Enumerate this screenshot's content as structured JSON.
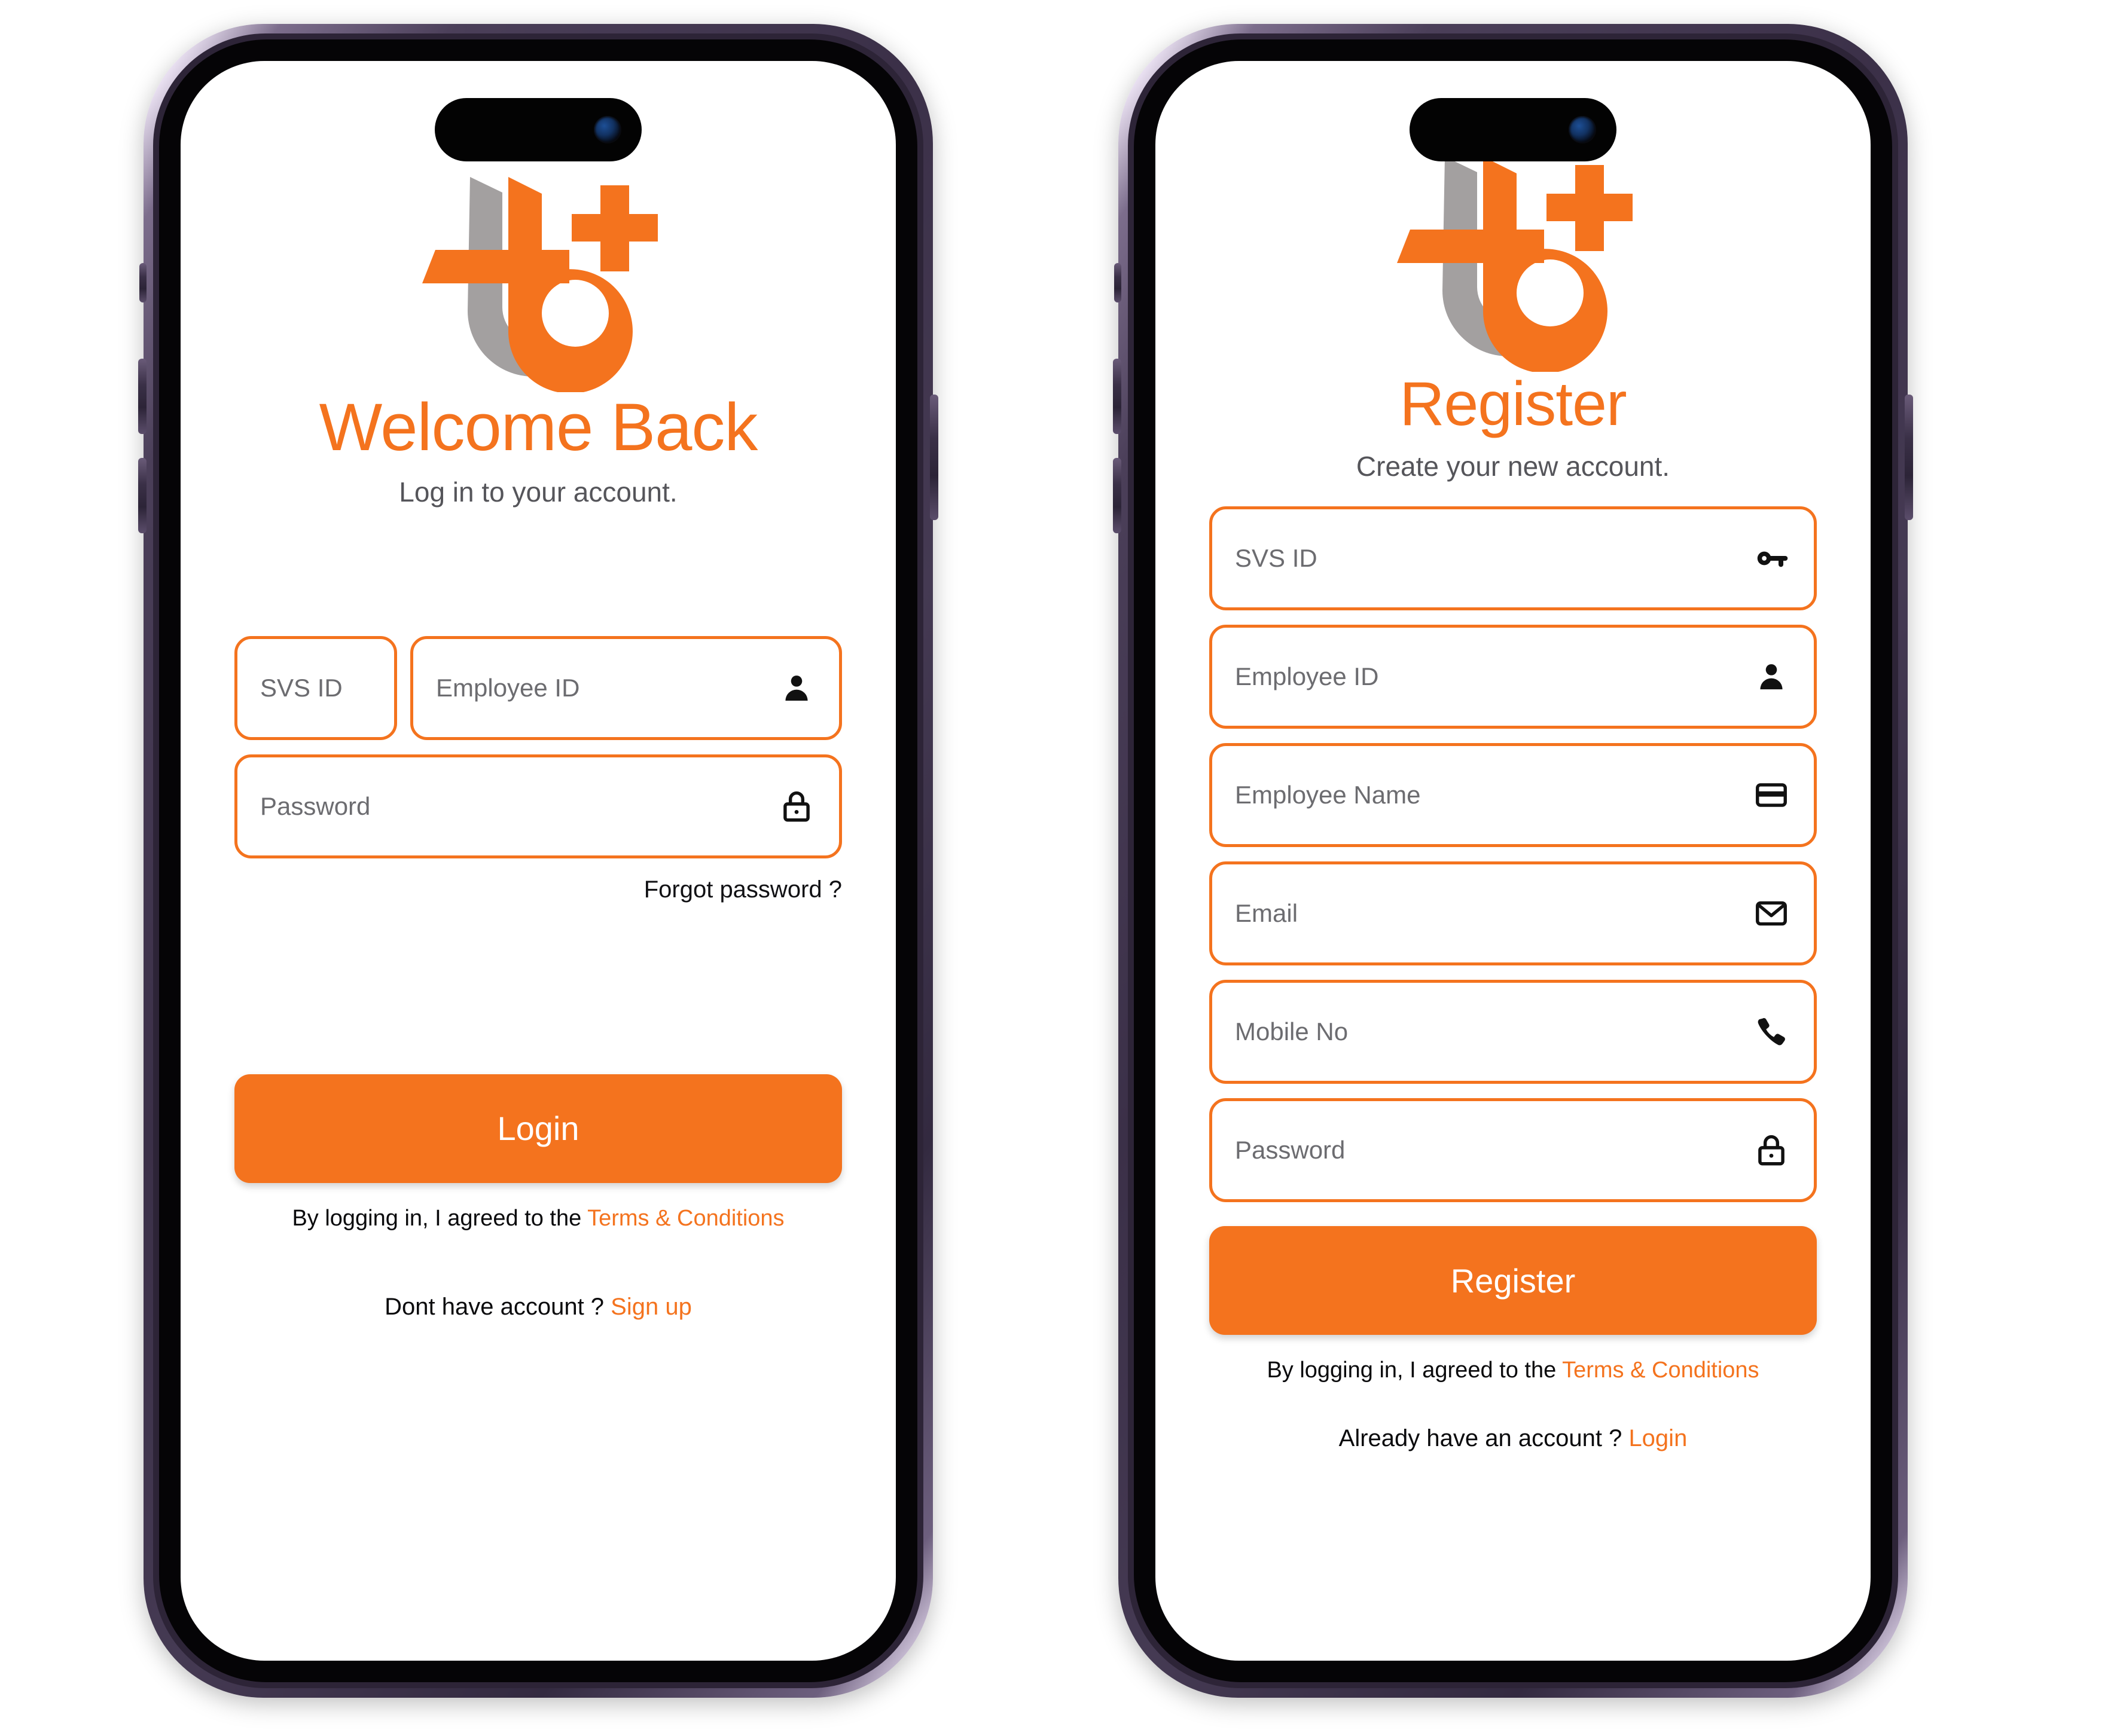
{
  "brand": {
    "accent_color": "#F4731E",
    "logo_gray": "#A3A0A0",
    "logo_name": "tb-plus-logo"
  },
  "login_screen": {
    "title": "Welcome Back",
    "subtitle": "Log in to your account.",
    "fields": [
      {
        "placeholder": "SVS ID",
        "icon": "none"
      },
      {
        "placeholder": "Employee ID",
        "icon": "person-icon"
      },
      {
        "placeholder": "Password",
        "icon": "lock-icon"
      }
    ],
    "forgot_password": "Forgot password ?",
    "submit_label": "Login",
    "terms_prefix": "By logging in, I agreed to the ",
    "terms_link": "Terms & Conditions",
    "footer_prefix": "Dont have account ? ",
    "footer_link": "Sign up"
  },
  "register_screen": {
    "title": "Register",
    "subtitle": "Create your new account.",
    "fields": [
      {
        "placeholder": "SVS ID",
        "icon": "key-icon"
      },
      {
        "placeholder": "Employee ID",
        "icon": "person-icon"
      },
      {
        "placeholder": "Employee Name",
        "icon": "card-icon"
      },
      {
        "placeholder": "Email",
        "icon": "envelope-icon"
      },
      {
        "placeholder": "Mobile No",
        "icon": "phone-icon"
      },
      {
        "placeholder": "Password",
        "icon": "lock-icon"
      }
    ],
    "submit_label": "Register",
    "terms_prefix": "By logging in, I agreed to the ",
    "terms_link": "Terms & Conditions",
    "footer_prefix": "Already have an account ? ",
    "footer_link": "Login"
  }
}
